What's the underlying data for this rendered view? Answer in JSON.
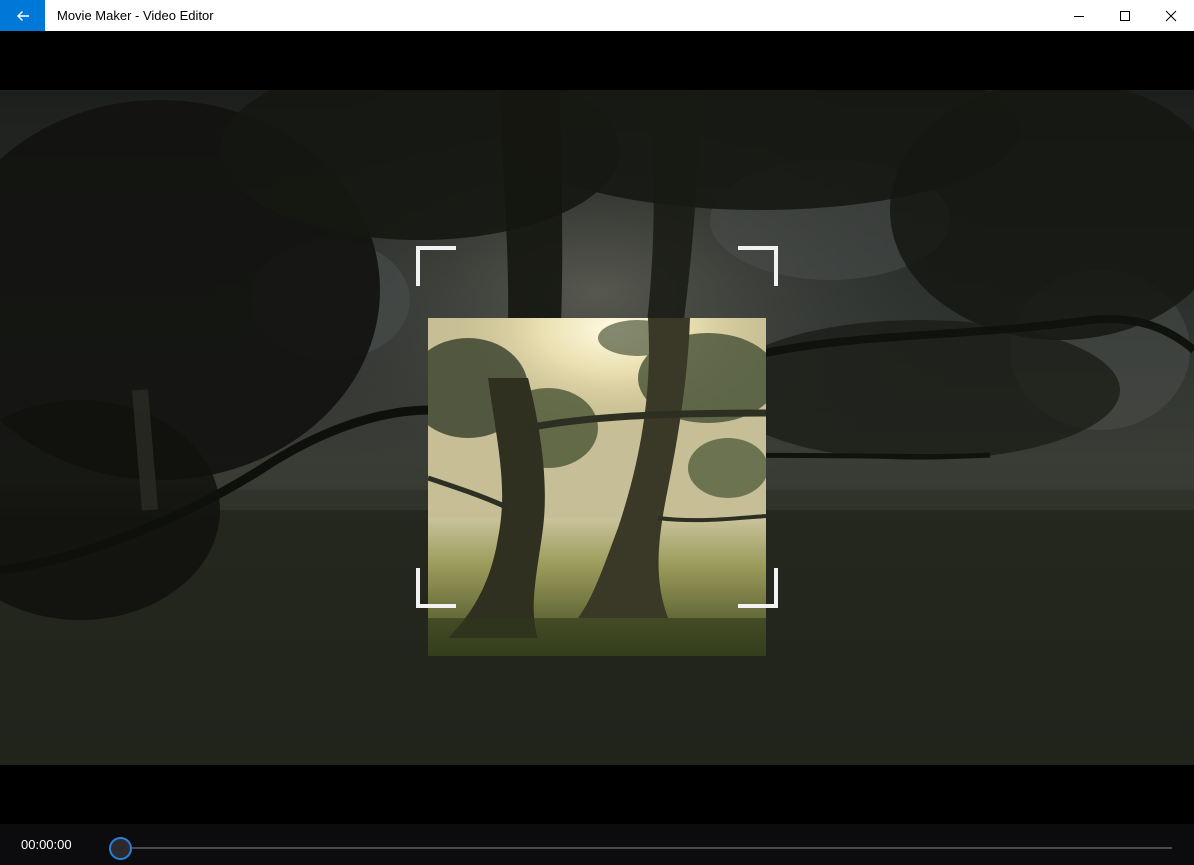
{
  "window": {
    "title": "Movie Maker - Video Editor",
    "accent_color": "#0078d7",
    "back_icon": "arrow-left-icon",
    "controls": [
      "minimize-icon",
      "maximize-icon",
      "close-icon"
    ]
  },
  "player": {
    "current_time": "00:00:00",
    "progress": 0,
    "seek_accent": "#2b7fd4"
  }
}
